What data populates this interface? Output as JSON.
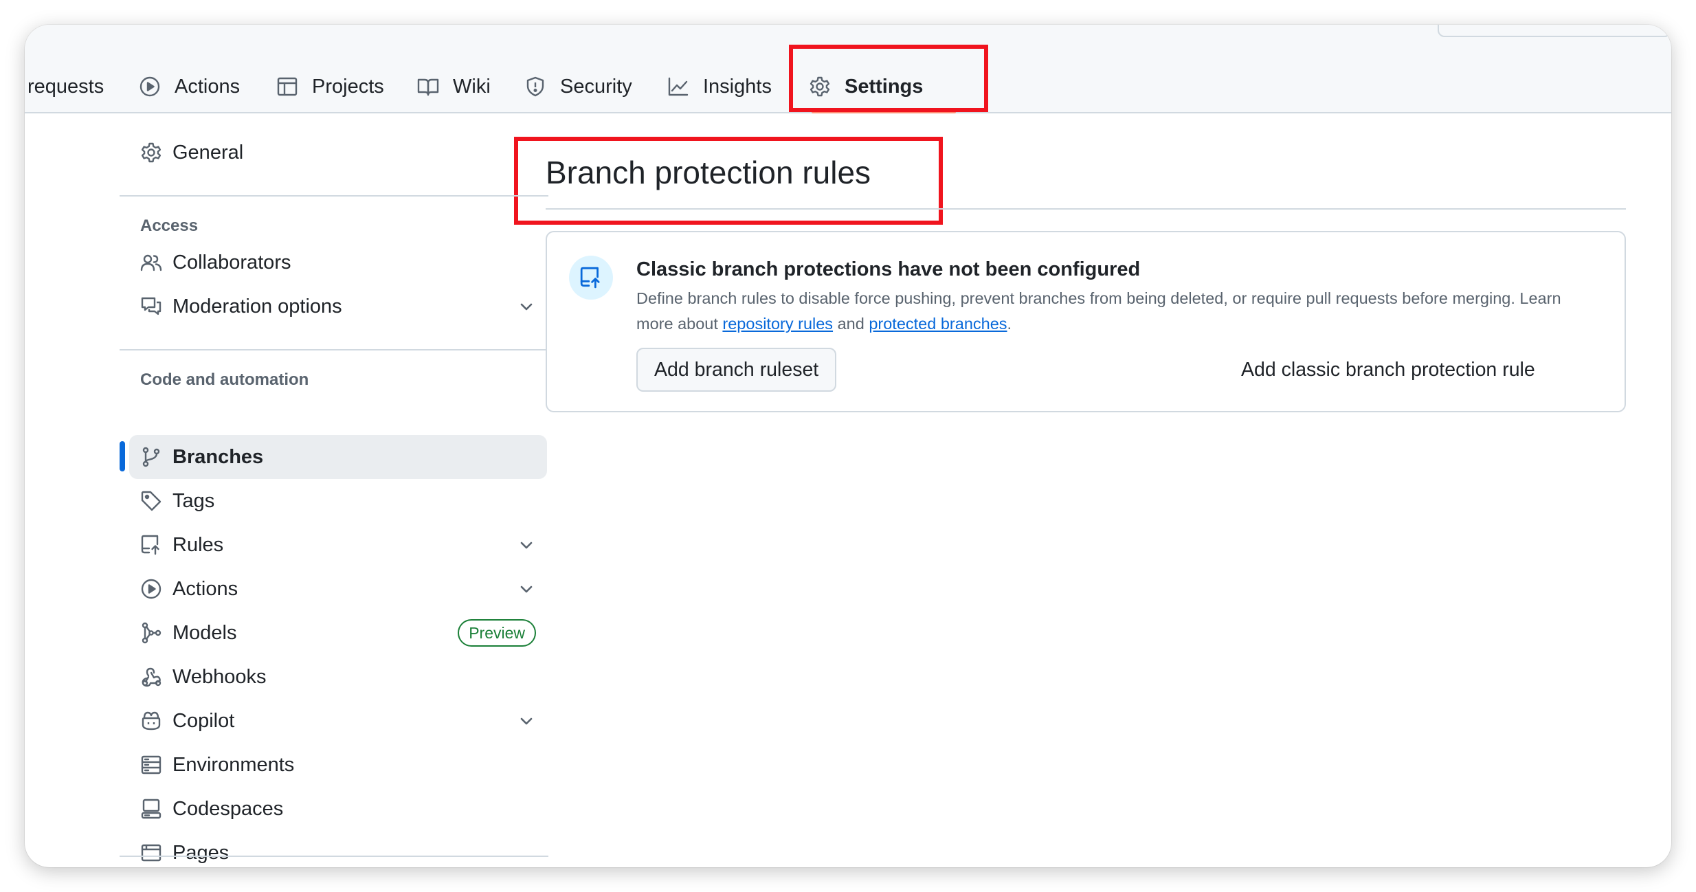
{
  "tabs": [
    {
      "label": "requests",
      "icon": "none"
    },
    {
      "label": "Actions",
      "icon": "play-icon"
    },
    {
      "label": "Projects",
      "icon": "table-icon"
    },
    {
      "label": "Wiki",
      "icon": "book-icon"
    },
    {
      "label": "Security",
      "icon": "shield-icon"
    },
    {
      "label": "Insights",
      "icon": "graph-icon"
    },
    {
      "label": "Settings",
      "icon": "gear-icon",
      "active": true
    }
  ],
  "sidebar": {
    "general": {
      "label": "General",
      "icon": "gear-icon"
    },
    "sections": [
      {
        "heading": "Access",
        "items": [
          {
            "label": "Collaborators",
            "icon": "people-icon"
          },
          {
            "label": "Moderation options",
            "icon": "comment-discussion-icon",
            "expandable": true
          }
        ]
      },
      {
        "heading": "Code and automation",
        "items": [
          {
            "label": "Branches",
            "icon": "git-branch-icon",
            "selected": true
          },
          {
            "label": "Tags",
            "icon": "tag-icon"
          },
          {
            "label": "Rules",
            "icon": "repo-push-icon",
            "expandable": true
          },
          {
            "label": "Actions",
            "icon": "play-icon",
            "expandable": true
          },
          {
            "label": "Models",
            "icon": "ai-model-icon",
            "badge": "Preview"
          },
          {
            "label": "Webhooks",
            "icon": "webhook-icon"
          },
          {
            "label": "Copilot",
            "icon": "copilot-icon",
            "expandable": true
          },
          {
            "label": "Environments",
            "icon": "server-icon"
          },
          {
            "label": "Codespaces",
            "icon": "codespaces-icon"
          },
          {
            "label": "Pages",
            "icon": "browser-icon"
          }
        ]
      }
    ]
  },
  "main": {
    "title": "Branch protection rules",
    "card": {
      "icon": "repo-push-icon",
      "title": "Classic branch protections have not been configured",
      "desc_prefix": "Define branch rules to disable force pushing, prevent branches from being deleted, or require pull requests before merging. Learn more about ",
      "link1": "repository rules",
      "desc_mid": " and ",
      "link2": "protected branches",
      "desc_suffix": ".",
      "primary_button": "Add branch ruleset",
      "secondary_button": "Add classic branch protection rule"
    }
  },
  "colors": {
    "accent": "#0969da",
    "highlight": "#f0141e",
    "preview_badge": "#1a7f37",
    "tab_underline": "#fd8c73"
  }
}
